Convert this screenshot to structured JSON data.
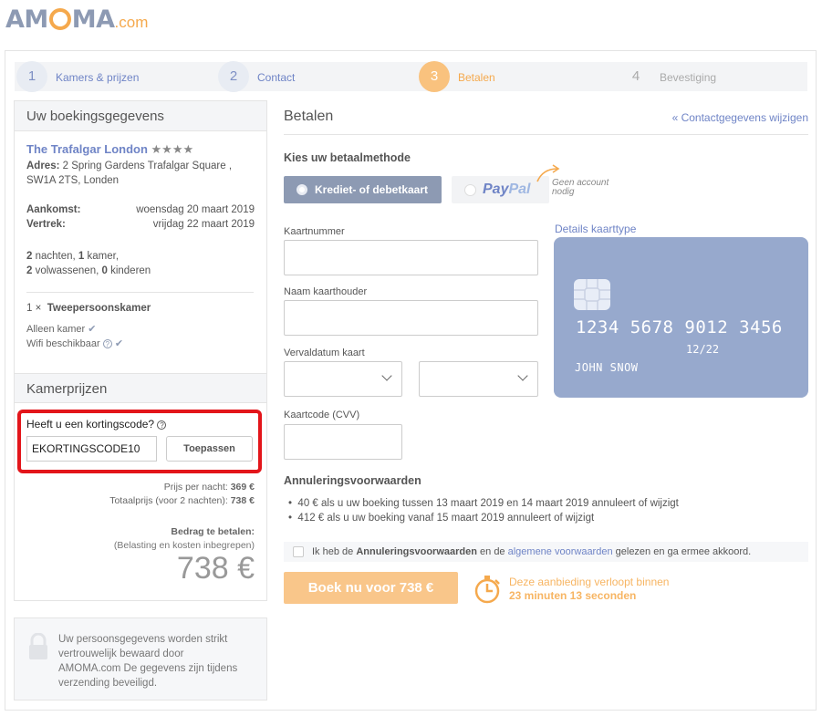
{
  "logo": {
    "part1": "AM",
    "part2": "MA",
    "tld": ".com"
  },
  "steps": [
    {
      "num": "1",
      "label": "Kamers & prijzen"
    },
    {
      "num": "2",
      "label": "Contact"
    },
    {
      "num": "3",
      "label": "Betalen"
    },
    {
      "num": "4",
      "label": "Bevestiging"
    }
  ],
  "booking": {
    "title": "Uw boekingsgegevens",
    "hotel": "The Trafalgar London",
    "stars": "★★★★",
    "address_label": "Adres:",
    "address_line1": "2 Spring Gardens Trafalgar Square ,",
    "address_line2": "SW1A 2TS, Londen",
    "arrival_label": "Aankomst:",
    "arrival_value": "woensdag 20 maart 2019",
    "departure_label": "Vertrek:",
    "departure_value": "vrijdag 22 maart 2019",
    "nights_num": "2",
    "nights_text": " nachten, ",
    "rooms_num": "1",
    "rooms_text": " kamer,",
    "adults_num": "2",
    "adults_text": " volwassenen, ",
    "children_num": "0",
    "children_text": " kinderen",
    "room_qty": "1 ×",
    "room_type": "Tweepersoonskamer",
    "feature1": "Alleen kamer",
    "feature2": "Wifi beschikbaar"
  },
  "prices": {
    "title": "Kamerprijzen",
    "promo_question": "Heeft u een kortingscode?",
    "promo_value": "EKORTINGSCODE10",
    "promo_button": "Toepassen",
    "per_night_label": "Prijs per nacht:",
    "per_night_value": "369 €",
    "total_label": "Totaalprijs (voor 2 nachten):",
    "total_value": "738 €",
    "due_label": "Bedrag te betalen:",
    "due_note": "(Belasting en kosten inbegrepen)",
    "due_amount": "738 €"
  },
  "privacy": {
    "line1": "Uw persoonsgegevens worden strikt",
    "line2": "vertrouwelijk bewaard door",
    "line3": "AMOMA.com De gegevens zijn tijdens",
    "line4": "verzending beveiligd."
  },
  "payment": {
    "title": "Betalen",
    "edit_contact": "« Contactgegevens wijzigen",
    "method_title": "Kies uw betaalmethode",
    "card_option": "Krediet- of debetkaart",
    "paypal_pay": "Pay",
    "paypal_pal": "Pal",
    "paypal_note_line1": "Geen account",
    "paypal_note_line2": "nodig",
    "card_details_link": "Details kaarttype",
    "card_number_label": "Kaartnummer",
    "card_holder_label": "Naam kaarthouder",
    "expiry_label": "Vervaldatum kaart",
    "cvv_label": "Kaartcode (CVV)",
    "card_preview": {
      "number": "1234  5678  9012  3456",
      "valid_thru": "12/22",
      "name": "JOHN SNOW"
    }
  },
  "cancellation": {
    "title": "Annuleringsvoorwaarden",
    "rule1": "40 € als u uw boeking tussen 13 maart 2019 en 14 maart 2019 annuleert of wijzigt",
    "rule2": "412 € als u uw boeking vanaf 15 maart 2019 annuleert of wijzigt",
    "agree_pre": "Ik heb de ",
    "agree_bold": "Annuleringsvoorwaarden",
    "agree_mid": " en de ",
    "agree_link": "algemene voorwaarden",
    "agree_post": " gelezen en ga ermee akkoord."
  },
  "cta": {
    "book_button": "Boek nu voor 738 €",
    "timer_line1": "Deze aanbieding verloopt binnen",
    "timer_line2": "23 minuten 13 seconden"
  },
  "colors": {
    "accent": "#f5a94d",
    "link": "#6f84c6",
    "card": "#97a9cd",
    "highlight": "#e3151a"
  }
}
